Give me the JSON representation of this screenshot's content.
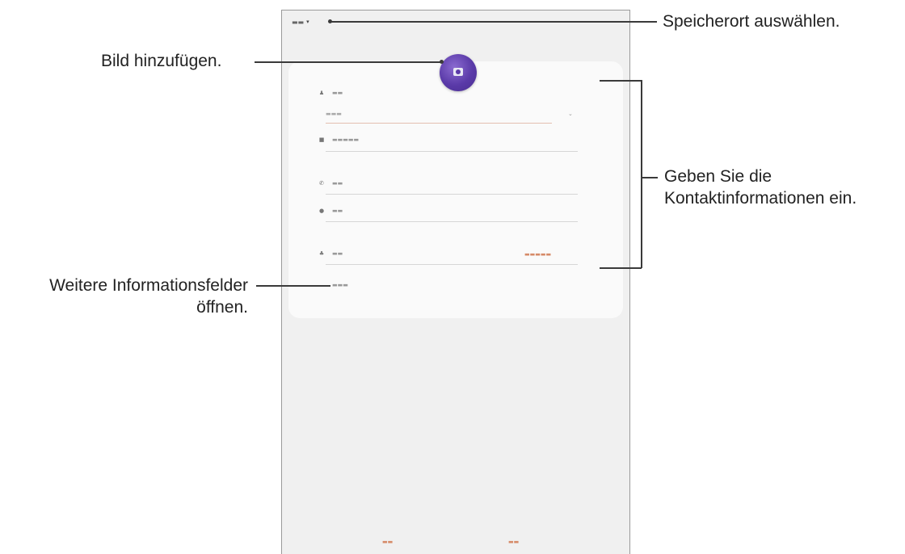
{
  "callouts": {
    "storage": "Speicherort auswählen.",
    "add_image": "Bild hinzufügen.",
    "contact_info_line1": "Geben Sie die",
    "contact_info_line2": "Kontaktinformationen ein.",
    "more_fields_line1": "Weitere Informationsfelder",
    "more_fields_line2": "öffnen."
  },
  "icons": {
    "person": "person-icon",
    "company": "building-icon",
    "phone": "phone-icon",
    "email": "email-icon",
    "groups": "groups-icon",
    "expand": "chevron-down-icon",
    "camera": "camera-icon"
  },
  "colors": {
    "accent": "#d68a68",
    "avatar": "#5a3aa8"
  }
}
